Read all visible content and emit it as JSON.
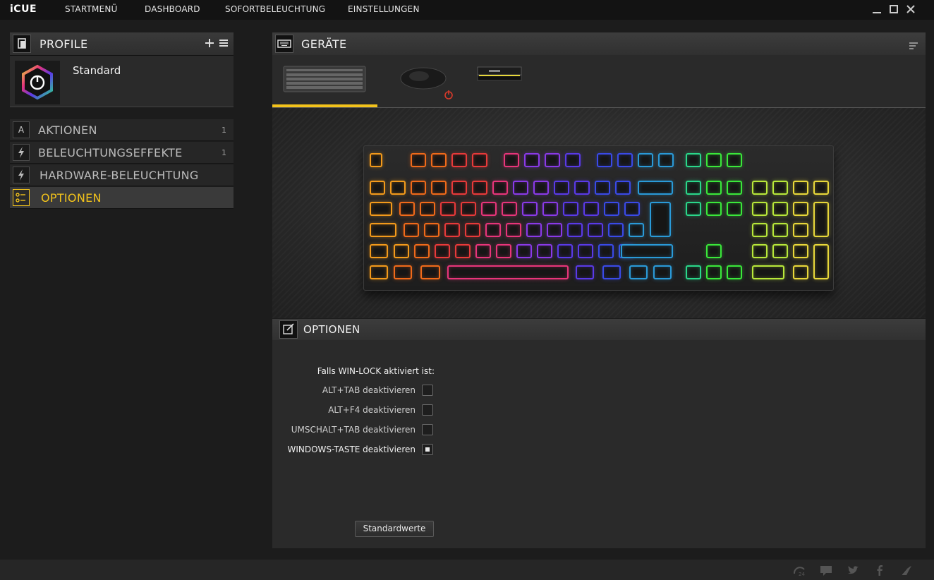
{
  "app": {
    "logo": "iCUE"
  },
  "menu": {
    "items": [
      "STARTMENÜ",
      "DASHBOARD",
      "SOFORTBELEUCHTUNG",
      "EINSTELLUNGEN"
    ]
  },
  "profiles": {
    "title": "PROFILE",
    "active_profile": "Standard"
  },
  "nav": [
    {
      "icon": "A",
      "label": "AKTIONEN",
      "count": "1"
    },
    {
      "icon": "lightning",
      "label": "BELEUCHTUNGSEFFEKTE",
      "count": "1"
    },
    {
      "icon": "lightning",
      "label": "HARDWARE-BELEUCHTUNG",
      "count": ""
    },
    {
      "icon": "options",
      "label": "OPTIONEN",
      "count": ""
    }
  ],
  "devices": {
    "title": "GERÄTE",
    "tabs": [
      "keyboard",
      "mouse",
      "memory"
    ],
    "selected": "keyboard"
  },
  "options": {
    "title": "OPTIONEN",
    "section_label": "Falls WIN-LOCK aktiviert ist:",
    "items": [
      {
        "label": "ALT+TAB deaktivieren",
        "checked": false
      },
      {
        "label": "ALT+F4 deaktivieren",
        "checked": false
      },
      {
        "label": "UMSCHALT+TAB deaktivieren",
        "checked": false
      },
      {
        "label": "WINDOWS-TASTE deaktivieren",
        "checked": true
      }
    ],
    "reset_button": "Standardwerte"
  },
  "footer": {
    "icons": [
      "cpuid-icon",
      "chat-icon",
      "twitter-icon",
      "facebook-icon",
      "corsair-icon"
    ]
  },
  "colors": {
    "accent": "#f3c31b",
    "rainbow": [
      "#f39a1b",
      "#f06a1a",
      "#e83a3a",
      "#e8357a",
      "#8a3ae8",
      "#5a3ae8",
      "#3a4ae8",
      "#2a9ad8",
      "#2ad88a",
      "#3ae83a",
      "#b8e83a",
      "#e8d83a"
    ]
  }
}
